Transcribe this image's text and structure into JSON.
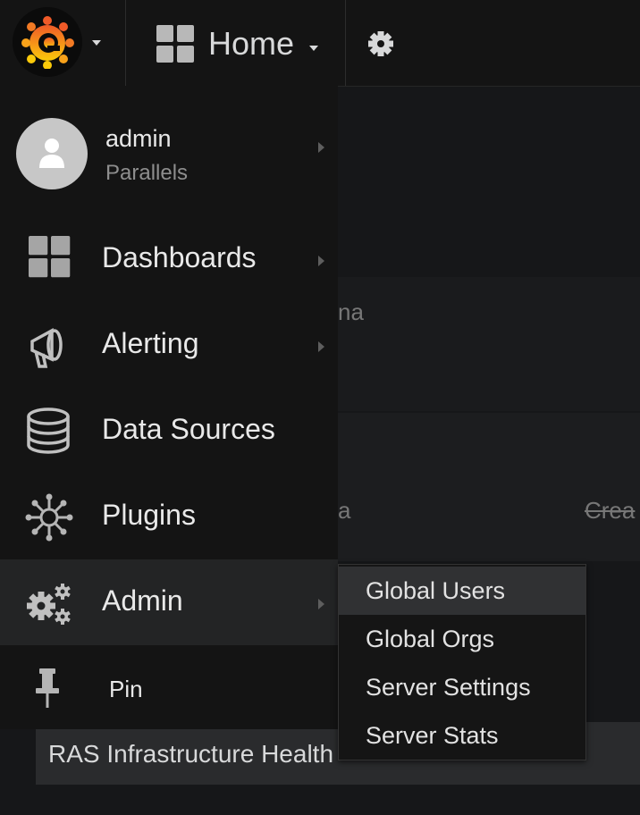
{
  "topbar": {
    "home_label": "Home",
    "logo_icon": "grafana-logo-icon",
    "settings_icon": "gear-icon"
  },
  "profile": {
    "name": "admin",
    "org": "Parallels"
  },
  "menu": {
    "items": [
      {
        "label": "Dashboards",
        "icon": "dashboards-grid-icon"
      },
      {
        "label": "Alerting",
        "icon": "megaphone-icon"
      },
      {
        "label": "Data Sources",
        "icon": "database-icon"
      },
      {
        "label": "Plugins",
        "icon": "plugins-icon"
      },
      {
        "label": "Admin",
        "icon": "cogs-icon"
      },
      {
        "label": "Pin",
        "icon": "pin-icon"
      }
    ]
  },
  "admin_submenu": {
    "items": [
      {
        "label": "Global Users"
      },
      {
        "label": "Global Orgs"
      },
      {
        "label": "Server Settings"
      },
      {
        "label": "Server Stats"
      }
    ]
  },
  "background": {
    "fragment_1": "na",
    "fragment_2": "a",
    "fragment_3": "Crea",
    "panel_title": "RAS Infrastructure Health"
  },
  "colors": {
    "accent_orange": "#f05a28",
    "accent_yellow": "#fbca0a",
    "menu_bg": "#141414",
    "active_bg": "#232425"
  }
}
